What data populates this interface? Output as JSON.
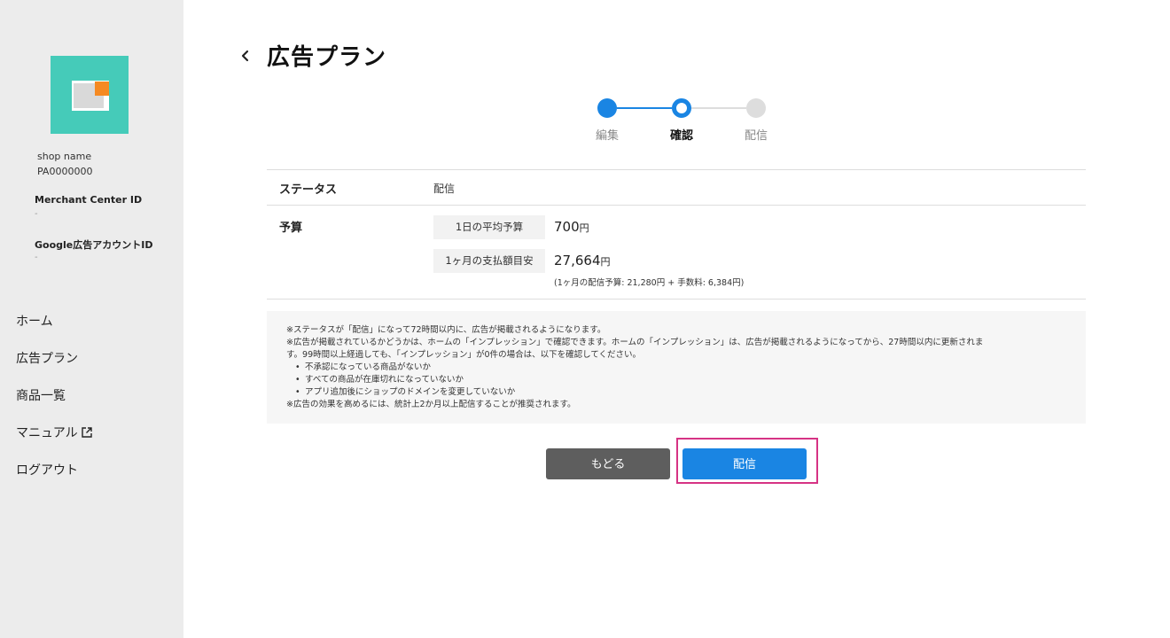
{
  "sidebar": {
    "shop_name": "shop name",
    "shop_id": "PA0000000",
    "merchant_center_label": "Merchant Center ID",
    "merchant_center_value": "-",
    "google_ads_label": "Google広告アカウントID",
    "google_ads_value": "-",
    "nav": {
      "home": "ホーム",
      "ad_plan": "広告プラン",
      "products": "商品一覧",
      "manual": "マニュアル",
      "logout": "ログアウト"
    }
  },
  "header": {
    "title": "広告プラン"
  },
  "stepper": {
    "steps": [
      "編集",
      "確認",
      "配信"
    ],
    "current": 1
  },
  "status": {
    "label": "ステータス",
    "value": "配信"
  },
  "budget": {
    "label": "予算",
    "daily_label": "1日の平均予算",
    "daily_value": "700",
    "monthly_label": "1ヶ月の支払額目安",
    "monthly_value": "27,664",
    "unit": "円",
    "note": "(1ヶ月の配信予算: 21,280円 + 手数料: 6,384円)"
  },
  "notice": {
    "line1": "※ステータスが「配信」になって72時間以内に、広告が掲載されるようになります。",
    "line2": "※広告が掲載されているかどうかは、ホームの「インプレッション」で確認できます。ホームの「インプレッション」は、広告が掲載されるようになってから、27時間以内に更新されま",
    "line3": "す。99時間以上経過しても、「インプレッション」が0件の場合は、以下を確認してください。",
    "bullets": [
      "不承認になっている商品がないか",
      "すべての商品が在庫切れになっていないか",
      "アプリ追加後にショップのドメインを変更していないか"
    ],
    "line4": "※広告の効果を高めるには、統計上2か月以上配信することが推奨されます。"
  },
  "buttons": {
    "back": "もどる",
    "deliver": "配信"
  },
  "colors": {
    "accent": "#1a85e3",
    "logo_bg": "#45cbb9",
    "logo_accent": "#f58a22",
    "highlight": "#d63384"
  }
}
